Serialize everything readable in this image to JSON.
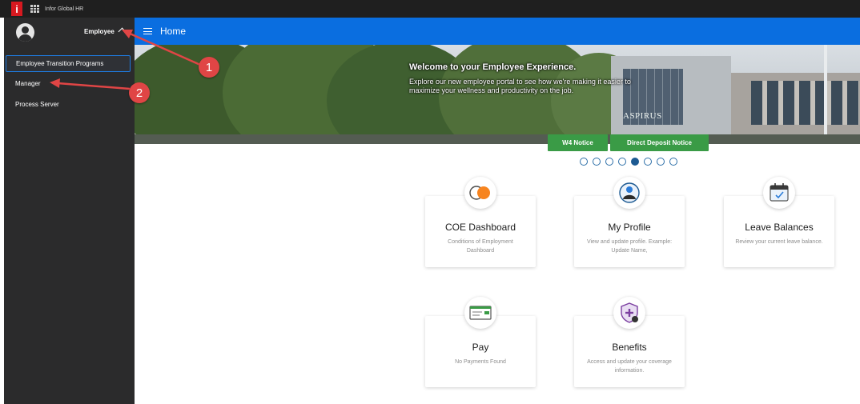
{
  "app": {
    "title": "Infor Global HR",
    "logo_letter": "i",
    "brand_color": "#d71920"
  },
  "sidebar": {
    "role_label": "Employee",
    "items": [
      {
        "label": "Employee Transition Programs",
        "active": true
      },
      {
        "label": "Manager",
        "active": false
      },
      {
        "label": "Process Server",
        "active": false
      }
    ]
  },
  "header": {
    "title": "Home",
    "color": "#0a6ee0"
  },
  "banner": {
    "headline": "Welcome to your Employee Experience.",
    "body": "Explore our new employee portal to see how we're making it easier to maximize your wellness and productivity on the job.",
    "sign_text": "ASPIRUS"
  },
  "notices": {
    "w4_label": "W4 Notice",
    "direct_deposit_label": "Direct Deposit Notice",
    "color": "#3a9b46"
  },
  "carousel": {
    "total": 8,
    "active_index": 4
  },
  "tiles": [
    {
      "title": "COE Dashboard",
      "description": "Conditions of Employment Dashboard",
      "icon": "coe-circles-icon"
    },
    {
      "title": "My Profile",
      "description": "View and update profile. Example: Update Name,",
      "icon": "profile-icon"
    },
    {
      "title": "Leave Balances",
      "description": "Review your current leave balance.",
      "icon": "calendar-icon"
    },
    {
      "title": "Pay",
      "description": "No Payments Found",
      "icon": "paycheck-icon"
    },
    {
      "title": "Benefits",
      "description": "Access and update your coverage information.",
      "icon": "shield-plus-icon"
    }
  ],
  "annotations": [
    {
      "label": "1"
    },
    {
      "label": "2"
    }
  ]
}
